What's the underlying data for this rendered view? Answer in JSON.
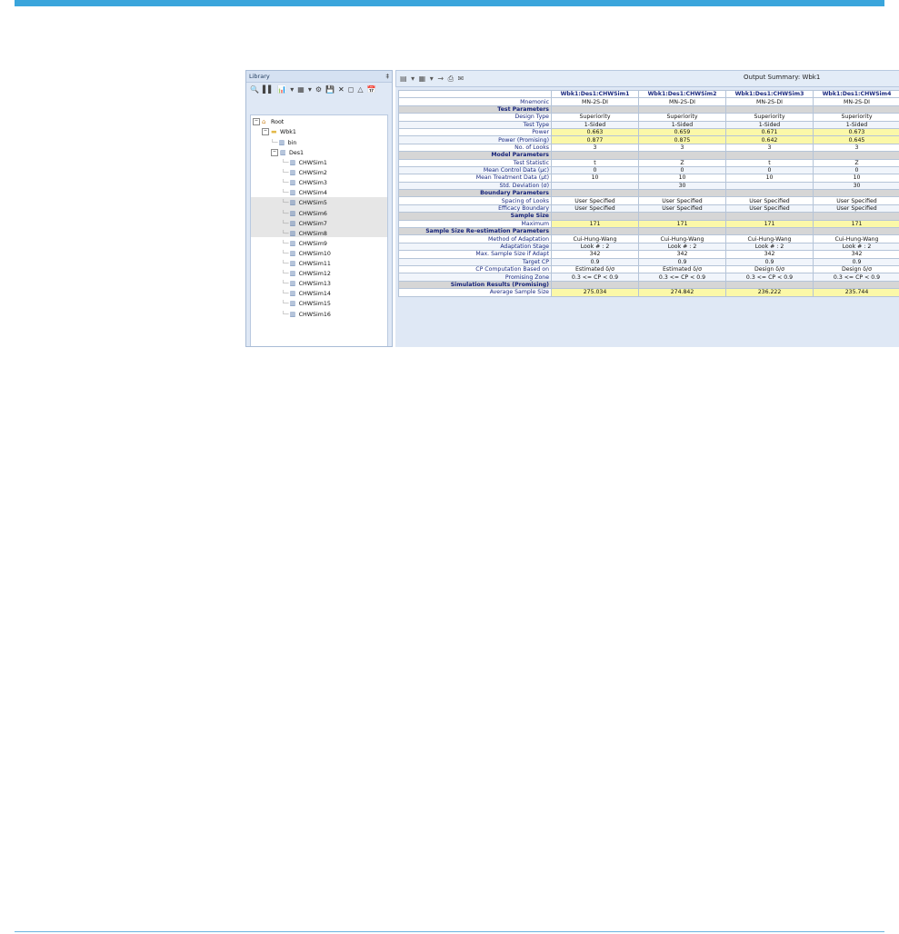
{
  "library": {
    "title": "Library",
    "pin_glyph": "‡",
    "toolbar_icons": [
      "🔍",
      "▌▌",
      "📊",
      "▾",
      "▦",
      "▾",
      "⚙",
      "💾",
      "✕",
      "◻",
      "△",
      "📅"
    ],
    "tree": {
      "root": "Root",
      "workbook": "Wbk1",
      "bin": "bin",
      "design": "Des1",
      "sims": [
        "CHWSim1",
        "CHWSim2",
        "CHWSim3",
        "CHWSim4",
        "CHWSim5",
        "CHWSim6",
        "CHWSim7",
        "CHWSim8",
        "CHWSim9",
        "CHWSim10",
        "CHWSim11",
        "CHWSim12",
        "CHWSim13",
        "CHWSim14",
        "CHWSim15",
        "CHWSim16"
      ]
    }
  },
  "output": {
    "title": "Output Summary: Wbk1",
    "toolbar_icons": "▤ ▾ ▦ ▾ → ⎙ ✉",
    "columns": [
      "Wbk1:Des1:CHWSim1",
      "Wbk1:Des1:CHWSim2",
      "Wbk1:Des1:CHWSim3",
      "Wbk1:Des1:CHWSim4"
    ],
    "rows": [
      {
        "kind": "row",
        "label": "Mnemonic",
        "values": [
          "MN-2S-DI",
          "MN-2S-DI",
          "MN-2S-DI",
          "MN-2S-DI"
        ]
      },
      {
        "kind": "section",
        "label": "Test Parameters"
      },
      {
        "kind": "row",
        "label": "Design Type",
        "values": [
          "Superiority",
          "Superiority",
          "Superiority",
          "Superiority"
        ]
      },
      {
        "kind": "row",
        "label": "Test Type",
        "values": [
          "1-Sided",
          "1-Sided",
          "1-Sided",
          "1-Sided"
        ]
      },
      {
        "kind": "yellow",
        "label": "Power",
        "values": [
          "0.663",
          "0.659",
          "0.671",
          "0.673"
        ]
      },
      {
        "kind": "yellow",
        "label": "Power (Promising)",
        "values": [
          "0.877",
          "0.875",
          "0.642",
          "0.645"
        ]
      },
      {
        "kind": "row",
        "label": "No. of Looks",
        "values": [
          "3",
          "3",
          "3",
          "3"
        ]
      },
      {
        "kind": "section",
        "label": "Model Parameters"
      },
      {
        "kind": "row",
        "label": "Test Statistic",
        "values": [
          "t",
          "Z",
          "t",
          "Z"
        ]
      },
      {
        "kind": "row",
        "label": "Mean Control Data (μc)",
        "values": [
          "0",
          "0",
          "0",
          "0"
        ]
      },
      {
        "kind": "row",
        "label": "Mean Treatment Data (μt)",
        "values": [
          "10",
          "10",
          "10",
          "10"
        ]
      },
      {
        "kind": "row",
        "label": "Std. Deviation (σ)",
        "values": [
          "",
          "30",
          "",
          "30"
        ]
      },
      {
        "kind": "section",
        "label": "Boundary Parameters"
      },
      {
        "kind": "row",
        "label": "Spacing of Looks",
        "values": [
          "User Specified",
          "User Specified",
          "User Specified",
          "User Specified"
        ]
      },
      {
        "kind": "row",
        "label": "Efficacy Boundary",
        "values": [
          "User Specified",
          "User Specified",
          "User Specified",
          "User Specified"
        ]
      },
      {
        "kind": "section",
        "label": "Sample Size"
      },
      {
        "kind": "yellow",
        "label": "Maximum",
        "values": [
          "171",
          "171",
          "171",
          "171"
        ]
      },
      {
        "kind": "section",
        "label": "Sample Size Re-estimation Parameters"
      },
      {
        "kind": "row",
        "label": "Method of Adaptation",
        "values": [
          "Cui-Hung-Wang",
          "Cui-Hung-Wang",
          "Cui-Hung-Wang",
          "Cui-Hung-Wang"
        ]
      },
      {
        "kind": "row",
        "label": "Adaptation Stage",
        "values": [
          "Look # : 2",
          "Look # : 2",
          "Look # : 2",
          "Look # : 2"
        ]
      },
      {
        "kind": "row",
        "label": "Max. Sample Size if Adapt",
        "values": [
          "342",
          "342",
          "342",
          "342"
        ]
      },
      {
        "kind": "row",
        "label": "Target CP",
        "values": [
          "0.9",
          "0.9",
          "0.9",
          "0.9"
        ]
      },
      {
        "kind": "row",
        "label": "CP Computation Based on",
        "values": [
          "Estimated δ/σ",
          "Estimated δ/σ",
          "Design δ/σ",
          "Design δ/σ"
        ]
      },
      {
        "kind": "row",
        "label": "Promising Zone",
        "values": [
          "0.3 <= CP < 0.9",
          "0.3 <= CP < 0.9",
          "0.3 <= CP < 0.9",
          "0.3 <= CP < 0.9"
        ]
      },
      {
        "kind": "section",
        "label": "Simulation Results (Promising)"
      },
      {
        "kind": "yellow",
        "label": "Average Sample Size",
        "values": [
          "275.034",
          "274.842",
          "236.222",
          "235.744"
        ]
      }
    ]
  }
}
